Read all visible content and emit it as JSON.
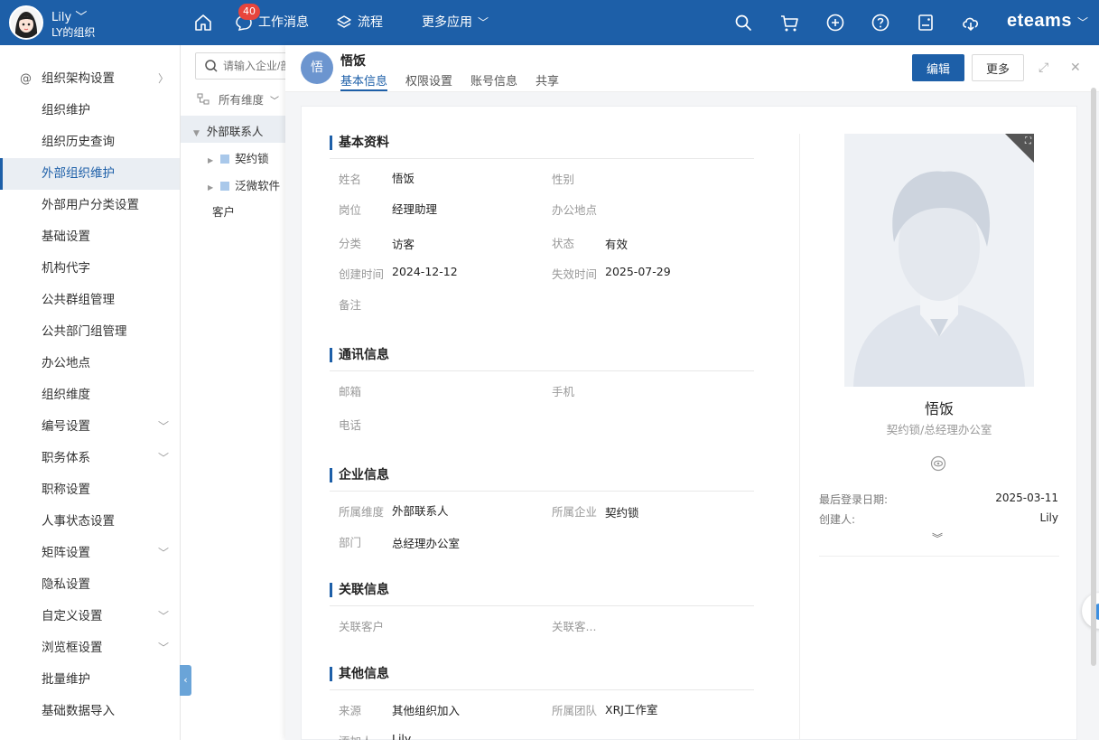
{
  "topbar": {
    "user_name": "Lily",
    "user_org": "LY的组织",
    "badge_count": "40",
    "nav": [
      "工作消息",
      "流程",
      "更多应用"
    ],
    "brand": "eteams"
  },
  "leftmenu": {
    "items": [
      {
        "label": "组织架构设置",
        "has_chevron": "right"
      },
      {
        "label": "组织维护"
      },
      {
        "label": "组织历史查询"
      },
      {
        "label": "外部组织维护",
        "active": true
      },
      {
        "label": "外部用户分类设置"
      },
      {
        "label": "基础设置"
      },
      {
        "label": "机构代字"
      },
      {
        "label": "公共群组管理"
      },
      {
        "label": "公共部门组管理"
      },
      {
        "label": "办公地点"
      },
      {
        "label": "组织维度"
      },
      {
        "label": "编号设置",
        "has_chevron": "down"
      },
      {
        "label": "职务体系",
        "has_chevron": "down"
      },
      {
        "label": "职称设置"
      },
      {
        "label": "人事状态设置"
      },
      {
        "label": "矩阵设置",
        "has_chevron": "down"
      },
      {
        "label": "隐私设置"
      },
      {
        "label": "自定义设置",
        "has_chevron": "down"
      },
      {
        "label": "浏览框设置",
        "has_chevron": "down"
      },
      {
        "label": "批量维护"
      },
      {
        "label": "基础数据导入"
      }
    ]
  },
  "tree": {
    "search_placeholder": "请输入企业/部门",
    "dimension": "所有维度",
    "root": "外部联系人",
    "children": [
      "契约锁",
      "泛微软件"
    ],
    "other": "客户"
  },
  "detail": {
    "avatar_char": "悟",
    "name": "悟饭",
    "tabs": [
      "基本信息",
      "权限设置",
      "账号信息",
      "共享"
    ],
    "edit_label": "编辑",
    "more_label": "更多",
    "sections": {
      "basic": {
        "title": "基本资料",
        "fields": {
          "name_label": "姓名",
          "name_value": "悟饭",
          "gender_label": "性别",
          "post_label": "岗位",
          "post_value": "经理助理",
          "office_label": "办公地点",
          "type_label": "分类",
          "type_value": "访客",
          "status_label": "状态",
          "status_value": "有效",
          "created_label": "创建时间",
          "created_value": "2024-12-12",
          "expire_label": "失效时间",
          "expire_value": "2025-07-29",
          "remark_label": "备注"
        }
      },
      "contact": {
        "title": "通讯信息",
        "fields": {
          "email_label": "邮箱",
          "mobile_label": "手机",
          "phone_label": "电话"
        }
      },
      "enterprise": {
        "title": "企业信息",
        "fields": {
          "dim_label": "所属维度",
          "dim_value": "外部联系人",
          "company_label": "所属企业",
          "company_value": "契约锁",
          "dept_label": "部门",
          "dept_value": "总经理办公室"
        }
      },
      "related": {
        "title": "关联信息",
        "fields": {
          "customer_label": "关联客户",
          "customer2_label": "关联客..."
        }
      },
      "other": {
        "title": "其他信息",
        "fields": {
          "source_label": "来源",
          "source_value": "其他组织加入",
          "team_label": "所属团队",
          "team_value": "XRJ工作室",
          "adder_label": "添加人",
          "adder_value": "Lily"
        }
      }
    },
    "profile": {
      "name": "悟饭",
      "sub": "契约锁/总经理办公室",
      "last_login_label": "最后登录日期:",
      "last_login_value": "2025-03-11",
      "creator_label": "创建人:",
      "creator_value": "Lily"
    }
  },
  "colors": {
    "primary": "#1d5fa8",
    "badge": "#e8453c"
  }
}
